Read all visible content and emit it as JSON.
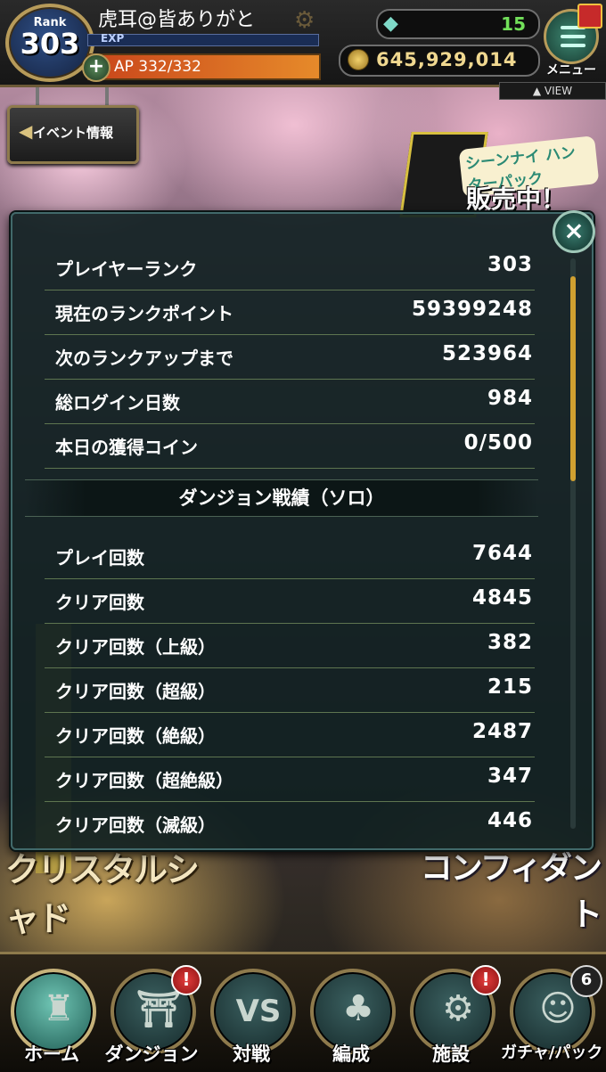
{
  "header": {
    "rank_label": "Rank",
    "rank_value": "303",
    "player_name": "虎耳@皆ありがと",
    "exp_label": "EXP",
    "ap_label": "AP",
    "ap_value": "332/332",
    "ap_plus": "+",
    "gems": "15",
    "coins": "645,929,014",
    "menu_label": "メニュー",
    "view_label": "VIEW"
  },
  "event_button": {
    "label": "イベント情報"
  },
  "promo": {
    "title": "シーンナイ ハンターパック",
    "sale": "販売中！"
  },
  "background": {
    "banner_left": "クリスタルシャド",
    "banner_right": "コンフィダント"
  },
  "panel": {
    "close": "×",
    "stats": [
      {
        "label": "プレイヤーランク",
        "value": "303"
      },
      {
        "label": "現在のランクポイント",
        "value": "59399248"
      },
      {
        "label": "次のランクアップまで",
        "value": "523964"
      },
      {
        "label": "総ログイン日数",
        "value": "984"
      },
      {
        "label": "本日の獲得コイン",
        "value": "0/500"
      }
    ],
    "section_title": "ダンジョン戦績（ソロ）",
    "dungeon": [
      {
        "label": "プレイ回数",
        "value": "7644"
      },
      {
        "label": "クリア回数",
        "value": "4845"
      },
      {
        "label": "クリア回数（上級）",
        "value": "382"
      },
      {
        "label": "クリア回数（超級）",
        "value": "215"
      },
      {
        "label": "クリア回数（絶級）",
        "value": "2487"
      },
      {
        "label": "クリア回数（超絶級）",
        "value": "347"
      },
      {
        "label": "クリア回数（滅級）",
        "value": "446"
      }
    ]
  },
  "nav": {
    "home": "ホーム",
    "dungeon": "ダンジョン",
    "battle": "対戦",
    "deck": "編成",
    "facility": "施設",
    "gacha": "ガチャ/パック",
    "alert": "!",
    "gacha_count": "6",
    "vs_glyph": "VS"
  }
}
